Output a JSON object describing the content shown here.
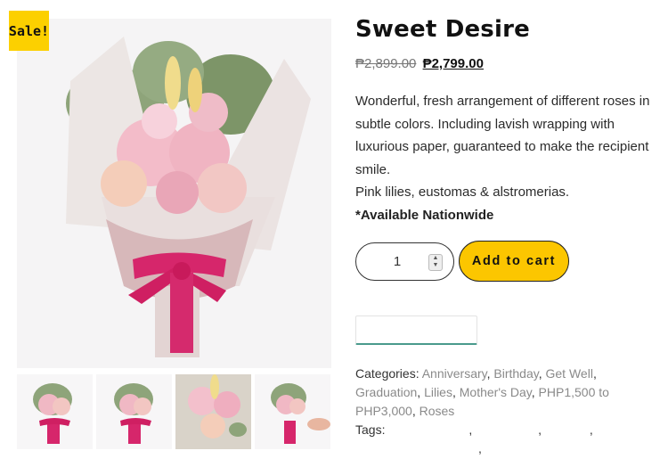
{
  "badge": {
    "label": "Sale!"
  },
  "product": {
    "title": "Sweet Desire",
    "price_old": "₱2,899.00",
    "price_new": "₱2,799.00",
    "description_lines": [
      "Wonderful, fresh arrangement of different roses in",
      "subtle colors. Including lavish wrapping with",
      "luxurious paper, guaranteed to make the recipient",
      "smile.",
      "Pink lilies, eustomas & alstromerias."
    ],
    "availability": "*Available Nationwide"
  },
  "cart": {
    "quantity": "1",
    "add_label": "Add to cart"
  },
  "meta": {
    "categories_label": "Categories:",
    "categories": [
      "Anniversary",
      "Birthday",
      "Get Well",
      "Graduation",
      "Lilies",
      "Mother's Day",
      "PHP1,500 to PHP3,000",
      "Roses"
    ],
    "tags_label": "Tags:"
  },
  "colors": {
    "badge": "#fcd000",
    "button": "#fcc600",
    "link": "#8a8a8a",
    "field_accent": "#4a9a8c"
  },
  "icons": {
    "spinner": "number-spinner-icon"
  }
}
